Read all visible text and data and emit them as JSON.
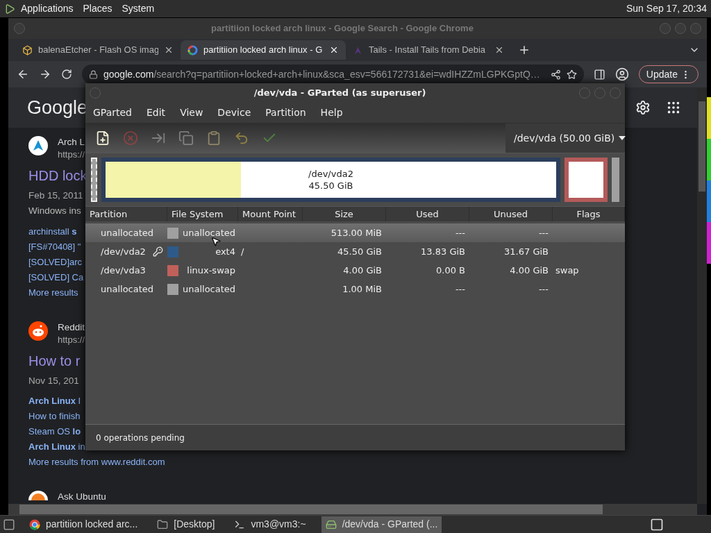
{
  "top_panel": {
    "menus": [
      "Applications",
      "Places",
      "System"
    ],
    "clock": "Sun Sep 17, 20:34"
  },
  "browser": {
    "title": "partitiion locked arch linux - Google Search - Google Chrome",
    "tabs": [
      {
        "label": "balenaEtcher - Flash OS imag",
        "kind": "cube",
        "selected": false
      },
      {
        "label": "partitiion locked arch linux - G",
        "kind": "google",
        "selected": true
      },
      {
        "label": "Tails - Install Tails from Debia",
        "kind": "tails",
        "selected": false
      }
    ],
    "url_host": "google.com",
    "url_path": "/search?q=partitiion+locked+arch+linux&sca_esv=566172731&ei=wdIHZZmLGPKGptQ…",
    "update_button": "Update",
    "page": {
      "logo": "Google",
      "results": [
        {
          "kind": "arch",
          "site": "Arch L",
          "url": "https://",
          "title": "HDD lock",
          "date": "Feb 15, 2011",
          "snippet": "Windows ins",
          "links": [
            "archinstall **s**",
            "[FS#70408] \"",
            "[SOLVED]arc",
            "[SOLVED] Ca",
            "More results"
          ]
        },
        {
          "kind": "reddit",
          "site": "Reddit",
          "url": "https://",
          "title": "How to r",
          "date": "Nov 15, 201",
          "links": [
            "**Arch Linux** I",
            "How to finish",
            "Steam OS **lo**",
            "**Arch Linux** in",
            "More results from www.reddit.com"
          ]
        },
        {
          "kind": "ubuntu",
          "site": "Ask Ubuntu"
        }
      ]
    }
  },
  "gparted": {
    "title": "/dev/vda - GParted (as superuser)",
    "menu": [
      "GParted",
      "Edit",
      "View",
      "Device",
      "Partition",
      "Help"
    ],
    "toolbar": [
      {
        "kind": "new",
        "disabled": false
      },
      {
        "kind": "delete",
        "disabled": true
      },
      {
        "kind": "resize",
        "disabled": true
      },
      {
        "kind": "copy",
        "disabled": true
      },
      {
        "kind": "paste",
        "disabled": true
      },
      {
        "kind": "undo",
        "disabled": true
      },
      {
        "kind": "apply",
        "disabled": true
      }
    ],
    "device": "/dev/vda (50.00 GiB)",
    "disk_map": [
      {
        "kind": "unallocated",
        "selected": true
      },
      {
        "kind": "partition",
        "color": "#2c3e5c",
        "level": 0.3,
        "label": "/dev/vda2",
        "size": "45.50 GiB",
        "selected": false
      },
      {
        "kind": "partition",
        "color": "#b45a5a",
        "selected": false
      },
      {
        "kind": "unallocated",
        "selected": false
      }
    ],
    "columns": [
      "Partition",
      "File System",
      "Mount Point",
      "Size",
      "Used",
      "Unused",
      "Flags"
    ],
    "rows": [
      {
        "partition": "unallocated",
        "color": "#a0a0a0",
        "file_system": "unallocated",
        "size": "513.00 MiB",
        "used": "---",
        "unused": "---",
        "mounted": false,
        "selected": true
      },
      {
        "partition": "/dev/vda2",
        "color": "#2e5a8a",
        "file_system": "ext4",
        "mount_point": "/",
        "size": "45.50 GiB",
        "used": "13.83 GiB",
        "unused": "31.67 GiB",
        "mounted": true,
        "selected": false
      },
      {
        "partition": "/dev/vda3",
        "color": "#c0605a",
        "file_system": "linux-swap",
        "size": "4.00 GiB",
        "used": "0.00 B",
        "unused": "4.00 GiB",
        "flags": "swap",
        "mounted": false,
        "selected": false
      },
      {
        "partition": "unallocated",
        "color": "#a0a0a0",
        "file_system": "unallocated",
        "size": "1.00 MiB",
        "used": "---",
        "unused": "---",
        "mounted": false,
        "selected": false
      }
    ],
    "status": "0 operations pending"
  },
  "taskbar": {
    "items": [
      {
        "kind": "chrome",
        "label": "partitiion locked arc...",
        "selected": false
      },
      {
        "kind": "folder",
        "label": "[Desktop]",
        "selected": false
      },
      {
        "kind": "terminal",
        "label": "vm3@vm3:~",
        "selected": false
      },
      {
        "kind": "gparted",
        "label": "/dev/vda - GParted (...",
        "selected": true
      }
    ]
  }
}
